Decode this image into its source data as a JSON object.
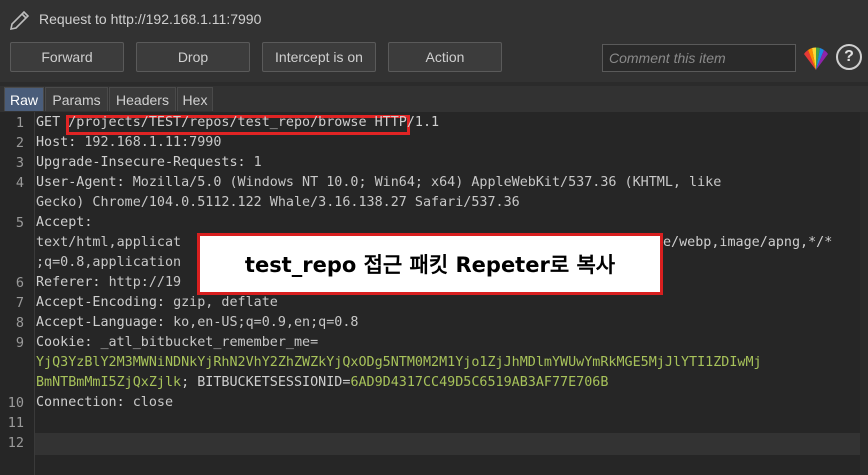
{
  "window": {
    "title": "Request to http://192.168.1.11:7990"
  },
  "toolbar": {
    "forward": "Forward",
    "drop": "Drop",
    "intercept": "Intercept is on",
    "action": "Action",
    "comment_placeholder": "Comment this item"
  },
  "tabs": [
    "Raw",
    "Params",
    "Headers",
    "Hex"
  ],
  "active_tab": "Raw",
  "lines": [
    {
      "n": "1",
      "parts": [
        [
          "k",
          "GET "
        ],
        [
          "k",
          "/projects/TEST/repos/test_repo/browse"
        ],
        [
          "k",
          " HTTP/1.1"
        ]
      ]
    },
    {
      "n": "2",
      "parts": [
        [
          "k",
          "Host: "
        ],
        [
          "val",
          "192.168.1.11:7990"
        ]
      ]
    },
    {
      "n": "3",
      "parts": [
        [
          "k",
          "Upgrade-Insecure-Requests: "
        ],
        [
          "val",
          "1"
        ]
      ]
    },
    {
      "n": "4",
      "parts": [
        [
          "k",
          "User-Agent: "
        ],
        [
          "val",
          "Mozilla/5.0 (Windows NT 10.0; Win64; x64) AppleWebKit/537.36 (KHTML, like"
        ]
      ]
    },
    {
      "n": "",
      "parts": [
        [
          "val",
          "Gecko) Chrome/104.0.5112.122 Whale/3.16.138.27 Safari/537.36"
        ]
      ]
    },
    {
      "n": "5",
      "parts": [
        [
          "k",
          "Accept:"
        ]
      ]
    },
    {
      "n": "",
      "parts": [
        [
          "val",
          "text/html,applicat"
        ]
      ],
      "tail": "e/webp,image/apng,*/*"
    },
    {
      "n": "",
      "parts": [
        [
          "val",
          ";q=0.8,application"
        ]
      ]
    },
    {
      "n": "6",
      "parts": [
        [
          "k",
          "Referer: "
        ],
        [
          "val",
          "http://19"
        ]
      ]
    },
    {
      "n": "7",
      "parts": [
        [
          "k",
          "Accept-Encoding: "
        ],
        [
          "val",
          "gzip, deflate"
        ]
      ]
    },
    {
      "n": "8",
      "parts": [
        [
          "k",
          "Accept-Language: "
        ],
        [
          "val",
          "ko,en-US;q=0.9,en;q=0.8"
        ]
      ]
    },
    {
      "n": "9",
      "parts": [
        [
          "k",
          "Cookie: "
        ],
        [
          "val",
          "_atl_bitbucket_remember_me="
        ]
      ]
    },
    {
      "n": "",
      "parts": [
        [
          "ck",
          "YjQ3YzBlY2M3MWNiNDNkYjRhN2VhY2ZhZWZkYjQxODg5NTM0M2M1Yjo1ZjJhMDlmYWUwYmRkMGE5MjJlYTI1ZDIwMj"
        ]
      ]
    },
    {
      "n": "",
      "parts": [
        [
          "ck",
          "BmNTBmMmI5ZjQxZjlk"
        ],
        [
          "k",
          "; "
        ],
        [
          "k",
          "BITBUCKETSESSIONID"
        ],
        [
          "k",
          "="
        ],
        [
          "ck",
          "6AD9D4317CC49D5C6519AB3AF77E706B"
        ]
      ]
    },
    {
      "n": "10",
      "parts": [
        [
          "k",
          "Connection: "
        ],
        [
          "val",
          "close"
        ]
      ]
    },
    {
      "n": "11",
      "parts": []
    },
    {
      "n": "12",
      "parts": []
    }
  ],
  "annotation": "test_repo 접근 패킷 Repeter로 복사",
  "colors": {
    "highlight": "#e02424",
    "cookie_value": "#a7c25a",
    "active_tab": "#4a5d7a"
  }
}
